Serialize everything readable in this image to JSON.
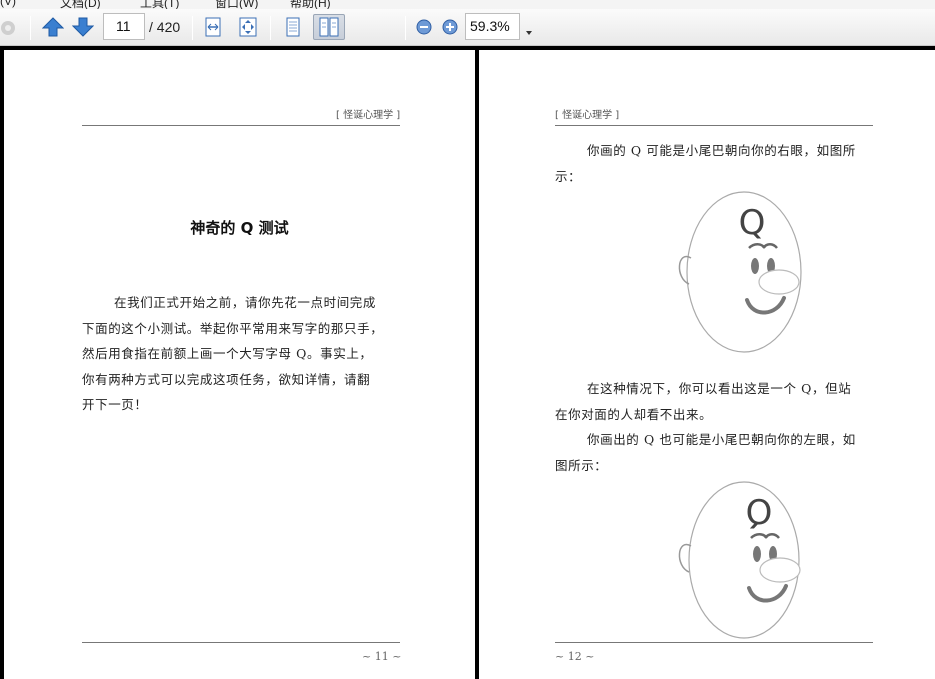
{
  "menu": {
    "items": [
      "(V)",
      "文档(D)",
      "工具(T)",
      "窗口(W)",
      "帮助(H)"
    ]
  },
  "toolbar": {
    "page_number": "11",
    "page_total": "/ 420",
    "zoom": "59.3%"
  },
  "icons": {
    "prev_page": "arrow-up-icon",
    "next_page": "arrow-down-icon",
    "fit_width": "fit-width-icon",
    "fit_page": "fit-page-icon",
    "single_page": "single-page-icon",
    "two_page": "two-page-icon",
    "zoom_out": "zoom-out-icon",
    "zoom_in": "zoom-in-icon"
  },
  "colors": {
    "toolbar_bg": "#efefef",
    "viewer_bg": "#000000",
    "page_bg": "#ffffff",
    "arrow_blue": "#3a7fd0"
  },
  "left_page": {
    "header": "[ 怪诞心理学 ]",
    "title": "神奇的 Q 测试",
    "lines": [
      "在我们正式开始之前，请你先花一点时间完成",
      "下面的这个小测试。举起你平常用来写字的那只手，",
      "然后用食指在前额上画一个大写字母 Q。事实上，",
      "你有两种方式可以完成这项任务，欲知详情，请翻",
      "开下一页！"
    ],
    "footer": "~ 11 ~"
  },
  "right_page": {
    "header": "[ 怪诞心理学 ]",
    "para1_lines": [
      "你画的 Q 可能是小尾巴朝向你的右眼，如图所",
      "示："
    ],
    "para2_lines": [
      "在这种情况下，你可以看出这是一个 Q，但站",
      "在你对面的人却看不出来。"
    ],
    "para3_lines": [
      "你画出的 Q 也可能是小尾巴朝向你的左眼，如",
      "图所示："
    ],
    "figure_letter": "Q",
    "footer": "~ 12 ~"
  }
}
